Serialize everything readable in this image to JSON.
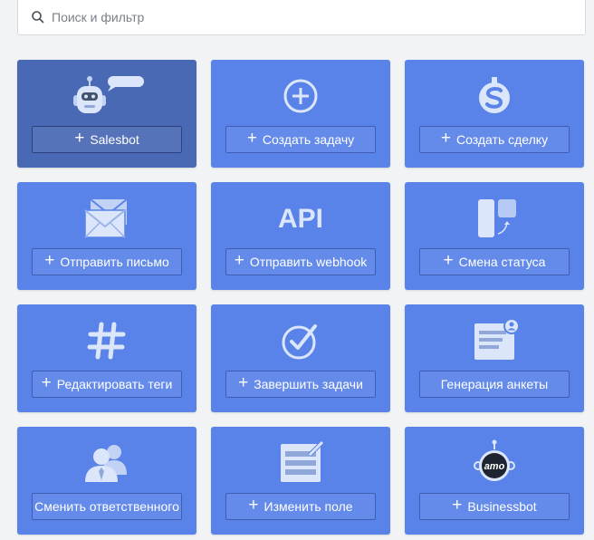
{
  "search": {
    "placeholder": "Поиск и фильтр"
  },
  "cards": [
    {
      "icon": "robot-icon",
      "label": "Salesbot",
      "plus": "+"
    },
    {
      "icon": "add-task-icon",
      "label": "Создать задачу",
      "plus": "+"
    },
    {
      "icon": "dollar-icon",
      "label": "Создать сделку",
      "plus": "+"
    },
    {
      "icon": "envelope-icon",
      "label": "Отправить письмо",
      "plus": "+"
    },
    {
      "icon": "api-icon",
      "label": "Отправить webhook",
      "plus": "+",
      "icon_text": "API"
    },
    {
      "icon": "status-change-icon",
      "label": "Смена статуса",
      "plus": "+"
    },
    {
      "icon": "hashtag-icon",
      "label": "Редактировать теги",
      "plus": "+"
    },
    {
      "icon": "check-circle-icon",
      "label": "Завершить задачи",
      "plus": "+"
    },
    {
      "icon": "form-icon",
      "label": "Генерация анкеты"
    },
    {
      "icon": "users-icon",
      "label": "Сменить ответственного"
    },
    {
      "icon": "edit-field-icon",
      "label": "Изменить поле",
      "plus": "+"
    },
    {
      "icon": "amo-bot-icon",
      "label": "Businessbot",
      "plus": "+",
      "icon_text": "amo"
    }
  ],
  "colors": {
    "card": "#5983e8",
    "card_selected": "#4a69b5",
    "icon_fill": "#dce6fb"
  }
}
